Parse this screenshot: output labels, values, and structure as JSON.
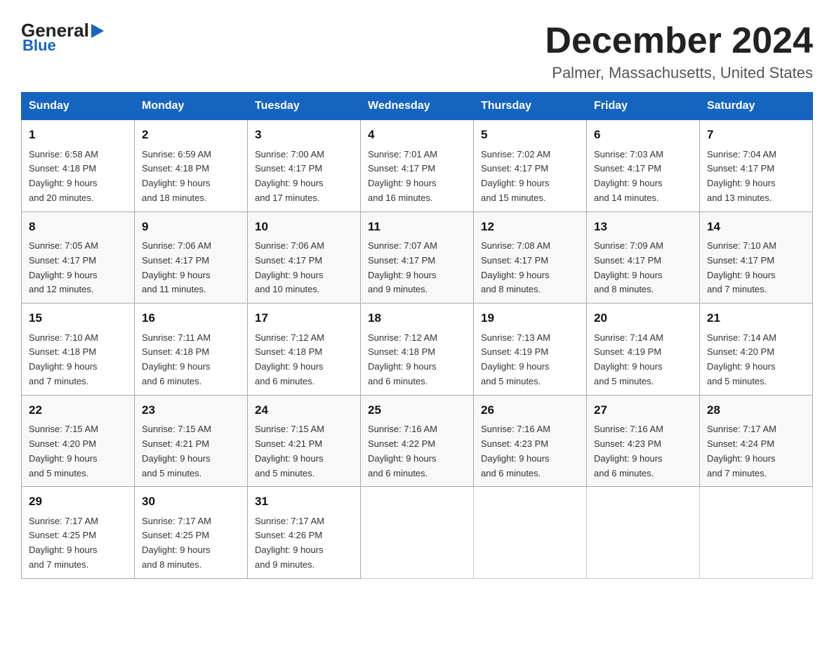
{
  "logo": {
    "general": "General",
    "blue": "Blue",
    "triangle": "▶"
  },
  "title": "December 2024",
  "location": "Palmer, Massachusetts, United States",
  "days_of_week": [
    "Sunday",
    "Monday",
    "Tuesday",
    "Wednesday",
    "Thursday",
    "Friday",
    "Saturday"
  ],
  "weeks": [
    [
      {
        "day": "1",
        "sunrise": "6:58 AM",
        "sunset": "4:18 PM",
        "daylight": "9 hours and 20 minutes."
      },
      {
        "day": "2",
        "sunrise": "6:59 AM",
        "sunset": "4:18 PM",
        "daylight": "9 hours and 18 minutes."
      },
      {
        "day": "3",
        "sunrise": "7:00 AM",
        "sunset": "4:17 PM",
        "daylight": "9 hours and 17 minutes."
      },
      {
        "day": "4",
        "sunrise": "7:01 AM",
        "sunset": "4:17 PM",
        "daylight": "9 hours and 16 minutes."
      },
      {
        "day": "5",
        "sunrise": "7:02 AM",
        "sunset": "4:17 PM",
        "daylight": "9 hours and 15 minutes."
      },
      {
        "day": "6",
        "sunrise": "7:03 AM",
        "sunset": "4:17 PM",
        "daylight": "9 hours and 14 minutes."
      },
      {
        "day": "7",
        "sunrise": "7:04 AM",
        "sunset": "4:17 PM",
        "daylight": "9 hours and 13 minutes."
      }
    ],
    [
      {
        "day": "8",
        "sunrise": "7:05 AM",
        "sunset": "4:17 PM",
        "daylight": "9 hours and 12 minutes."
      },
      {
        "day": "9",
        "sunrise": "7:06 AM",
        "sunset": "4:17 PM",
        "daylight": "9 hours and 11 minutes."
      },
      {
        "day": "10",
        "sunrise": "7:06 AM",
        "sunset": "4:17 PM",
        "daylight": "9 hours and 10 minutes."
      },
      {
        "day": "11",
        "sunrise": "7:07 AM",
        "sunset": "4:17 PM",
        "daylight": "9 hours and 9 minutes."
      },
      {
        "day": "12",
        "sunrise": "7:08 AM",
        "sunset": "4:17 PM",
        "daylight": "9 hours and 8 minutes."
      },
      {
        "day": "13",
        "sunrise": "7:09 AM",
        "sunset": "4:17 PM",
        "daylight": "9 hours and 8 minutes."
      },
      {
        "day": "14",
        "sunrise": "7:10 AM",
        "sunset": "4:17 PM",
        "daylight": "9 hours and 7 minutes."
      }
    ],
    [
      {
        "day": "15",
        "sunrise": "7:10 AM",
        "sunset": "4:18 PM",
        "daylight": "9 hours and 7 minutes."
      },
      {
        "day": "16",
        "sunrise": "7:11 AM",
        "sunset": "4:18 PM",
        "daylight": "9 hours and 6 minutes."
      },
      {
        "day": "17",
        "sunrise": "7:12 AM",
        "sunset": "4:18 PM",
        "daylight": "9 hours and 6 minutes."
      },
      {
        "day": "18",
        "sunrise": "7:12 AM",
        "sunset": "4:18 PM",
        "daylight": "9 hours and 6 minutes."
      },
      {
        "day": "19",
        "sunrise": "7:13 AM",
        "sunset": "4:19 PM",
        "daylight": "9 hours and 5 minutes."
      },
      {
        "day": "20",
        "sunrise": "7:14 AM",
        "sunset": "4:19 PM",
        "daylight": "9 hours and 5 minutes."
      },
      {
        "day": "21",
        "sunrise": "7:14 AM",
        "sunset": "4:20 PM",
        "daylight": "9 hours and 5 minutes."
      }
    ],
    [
      {
        "day": "22",
        "sunrise": "7:15 AM",
        "sunset": "4:20 PM",
        "daylight": "9 hours and 5 minutes."
      },
      {
        "day": "23",
        "sunrise": "7:15 AM",
        "sunset": "4:21 PM",
        "daylight": "9 hours and 5 minutes."
      },
      {
        "day": "24",
        "sunrise": "7:15 AM",
        "sunset": "4:21 PM",
        "daylight": "9 hours and 5 minutes."
      },
      {
        "day": "25",
        "sunrise": "7:16 AM",
        "sunset": "4:22 PM",
        "daylight": "9 hours and 6 minutes."
      },
      {
        "day": "26",
        "sunrise": "7:16 AM",
        "sunset": "4:23 PM",
        "daylight": "9 hours and 6 minutes."
      },
      {
        "day": "27",
        "sunrise": "7:16 AM",
        "sunset": "4:23 PM",
        "daylight": "9 hours and 6 minutes."
      },
      {
        "day": "28",
        "sunrise": "7:17 AM",
        "sunset": "4:24 PM",
        "daylight": "9 hours and 7 minutes."
      }
    ],
    [
      {
        "day": "29",
        "sunrise": "7:17 AM",
        "sunset": "4:25 PM",
        "daylight": "9 hours and 7 minutes."
      },
      {
        "day": "30",
        "sunrise": "7:17 AM",
        "sunset": "4:25 PM",
        "daylight": "9 hours and 8 minutes."
      },
      {
        "day": "31",
        "sunrise": "7:17 AM",
        "sunset": "4:26 PM",
        "daylight": "9 hours and 9 minutes."
      },
      null,
      null,
      null,
      null
    ]
  ]
}
